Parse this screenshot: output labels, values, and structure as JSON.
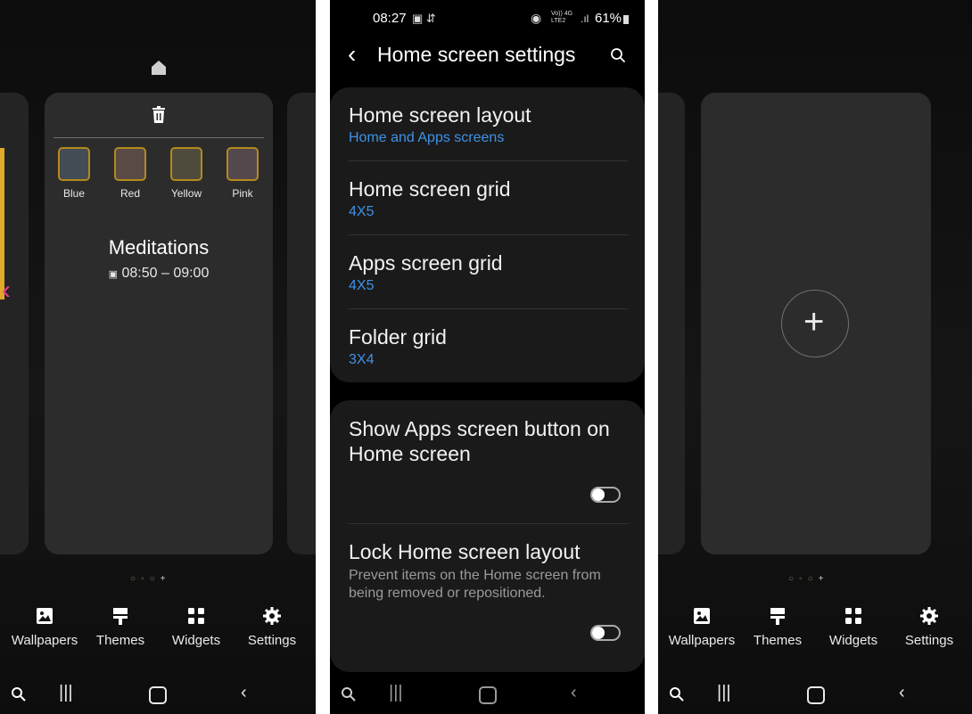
{
  "left": {
    "themes": [
      "Blue",
      "Red",
      "Yellow",
      "Pink"
    ],
    "event_title": "Meditations",
    "event_time": "08:50 – 09:00",
    "nav": [
      "Wallpapers",
      "Themes",
      "Widgets",
      "Settings"
    ]
  },
  "middle": {
    "status": {
      "time": "08:27",
      "battery": "61%",
      "network_top": "Vo)) 4G",
      "network_bottom": "LTE2"
    },
    "title": "Home screen settings",
    "items": [
      {
        "title": "Home screen layout",
        "value": "Home and Apps screens"
      },
      {
        "title": "Home screen grid",
        "value": "4X5"
      },
      {
        "title": "Apps screen grid",
        "value": "4X5"
      },
      {
        "title": "Folder grid",
        "value": "3X4"
      }
    ],
    "toggles": [
      {
        "title_line1": "Show Apps screen button on",
        "title_line2": "Home screen",
        "on": false
      },
      {
        "title": "Lock Home screen layout",
        "desc_line1": "Prevent items on the Home screen from",
        "desc_line2": "being removed or repositioned.",
        "on": false
      }
    ]
  },
  "right": {
    "nav": [
      "Wallpapers",
      "Themes",
      "Widgets",
      "Settings"
    ]
  },
  "colors": {
    "accent": "#3e91e8",
    "card": "#2c2c2c",
    "group_bg": "#1a1a1a"
  }
}
